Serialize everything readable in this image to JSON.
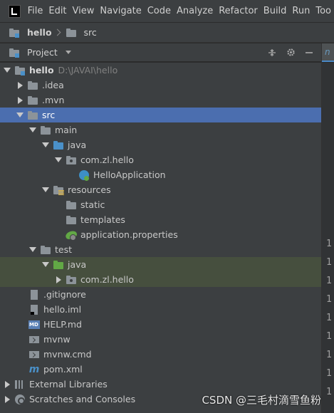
{
  "menu": {
    "items": [
      "File",
      "Edit",
      "View",
      "Navigate",
      "Code",
      "Analyze",
      "Refactor",
      "Build",
      "Run",
      "Too"
    ]
  },
  "navbar": {
    "crumbs": [
      "hello",
      "src"
    ]
  },
  "panel": {
    "title": "Project"
  },
  "tree": {
    "rows": [
      {
        "label": "hello",
        "path": "D:\\JAVAI\\hello",
        "icon": "module-folder-icon"
      },
      {
        "label": ".idea",
        "icon": "folder-icon"
      },
      {
        "label": ".mvn",
        "icon": "folder-icon"
      },
      {
        "label": "src",
        "icon": "folder-icon",
        "selected": true
      },
      {
        "label": "main",
        "icon": "folder-icon"
      },
      {
        "label": "java",
        "icon": "source-folder-icon"
      },
      {
        "label": "com.zl.hello",
        "icon": "package-icon"
      },
      {
        "label": "HelloApplication",
        "icon": "spring-class-icon"
      },
      {
        "label": "resources",
        "icon": "resources-folder-icon"
      },
      {
        "label": "static",
        "icon": "folder-icon"
      },
      {
        "label": "templates",
        "icon": "folder-icon"
      },
      {
        "label": "application.properties",
        "icon": "spring-properties-icon"
      },
      {
        "label": "test",
        "icon": "folder-icon"
      },
      {
        "label": "java",
        "icon": "test-source-folder-icon"
      },
      {
        "label": "com.zl.hello",
        "icon": "package-icon"
      },
      {
        "label": ".gitignore",
        "icon": "gitignore-file-icon"
      },
      {
        "label": "hello.iml",
        "icon": "iml-file-icon"
      },
      {
        "label": "HELP.md",
        "icon": "markdown-file-icon"
      },
      {
        "label": "mvnw",
        "icon": "shell-file-icon"
      },
      {
        "label": "mvnw.cmd",
        "icon": "shell-file-icon"
      },
      {
        "label": "pom.xml",
        "icon": "maven-icon"
      },
      {
        "label": "External Libraries",
        "icon": "libraries-icon"
      },
      {
        "label": "Scratches and Consoles",
        "icon": "scratches-icon"
      }
    ]
  },
  "editor": {
    "tab_letter": "n",
    "line_number_digit": "1"
  },
  "watermark": "CSDN @三毛村滴雪鱼粉"
}
